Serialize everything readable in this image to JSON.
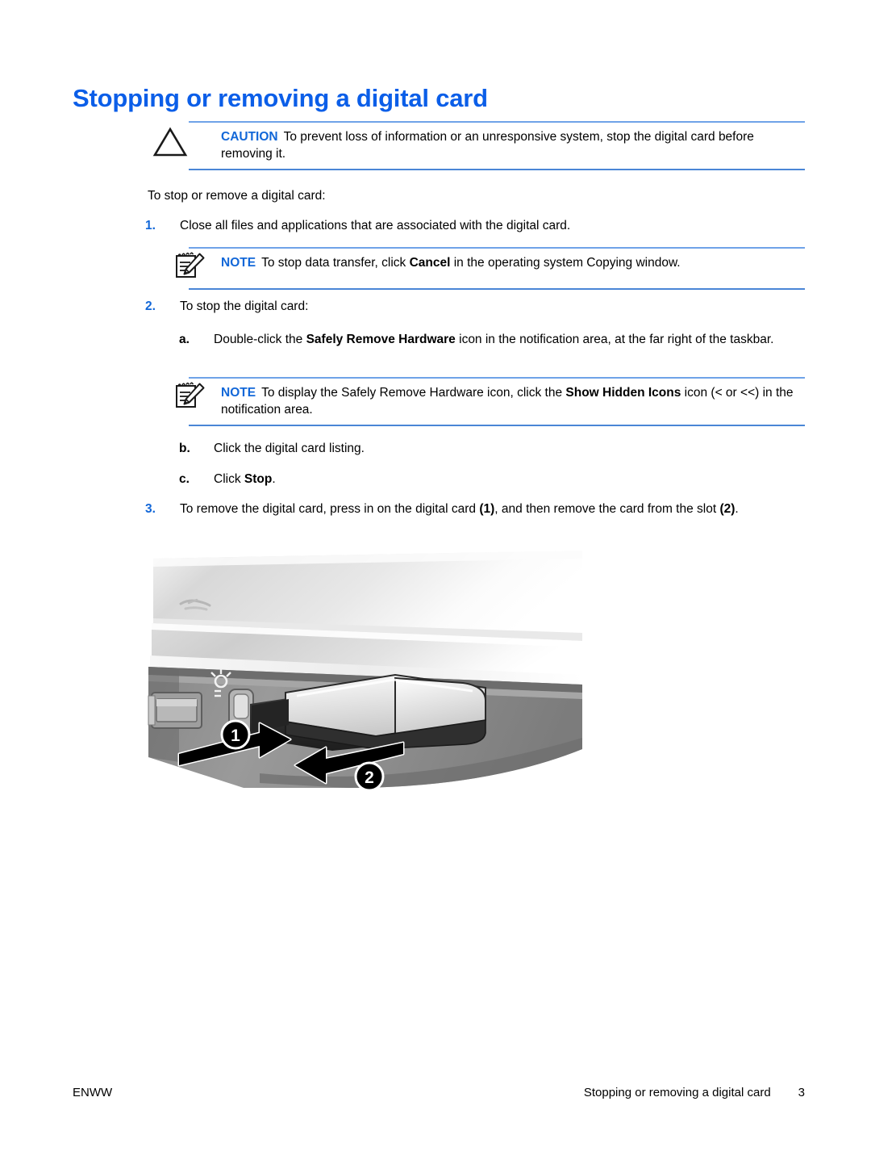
{
  "document": {
    "title": "Stopping or removing a digital card"
  },
  "caution": {
    "icon": "warning-triangle-icon",
    "label": "CAUTION",
    "text": "To prevent loss of information or an unresponsive system, stop the digital card before removing it."
  },
  "intro": {
    "text": "To stop or remove a digital card:"
  },
  "steps": [
    {
      "marker": "1.",
      "text": "Close all files and applications that are associated with the digital card."
    },
    {
      "marker": "2.",
      "text": "To stop the digital card:"
    },
    {
      "marker": "3.",
      "text_part1": "To remove the digital card, press in on the digital card ",
      "bold1": "(1)",
      "text_part2": ", and then remove the card from the slot ",
      "bold2": "(2)",
      "text_part3": "."
    }
  ],
  "substeps": [
    {
      "marker": "a.",
      "text_part1": "Double-click the ",
      "bold1": "Safely Remove Hardware",
      "text_part2": " icon in the notification area, at the far right of the taskbar."
    },
    {
      "marker": "b.",
      "text_part1": "Click the digital card listing.",
      "bold1": "",
      "text_part2": ""
    },
    {
      "marker": "c.",
      "text_part1": "Click ",
      "bold1": "Stop",
      "text_part2": "."
    }
  ],
  "note1": {
    "icon": "notepad-pencil-icon",
    "label": "NOTE",
    "text_part1": "To stop data transfer, click ",
    "bold1": "Cancel",
    "text_part2": " in the operating system Copying window."
  },
  "note2": {
    "icon": "notepad-pencil-icon",
    "label": "NOTE",
    "text_part1": "To display the Safely Remove Hardware icon, click the ",
    "bold1": "Show Hidden Icons",
    "text_part2": " icon (< or <<) in the notification area."
  },
  "figure": {
    "alt": "Laptop left side showing a digital card being pressed in and removed from the digital media slot",
    "callouts": [
      "1",
      "2"
    ]
  },
  "footer": {
    "left": "ENWW",
    "right": "Stopping or removing a digital card",
    "page": "3"
  },
  "colors": {
    "heading_blue": "#0b5ee8",
    "label_blue": "#1267d8",
    "rule_blue": "#6fa3e8",
    "marker_blue": "#1267d8"
  }
}
